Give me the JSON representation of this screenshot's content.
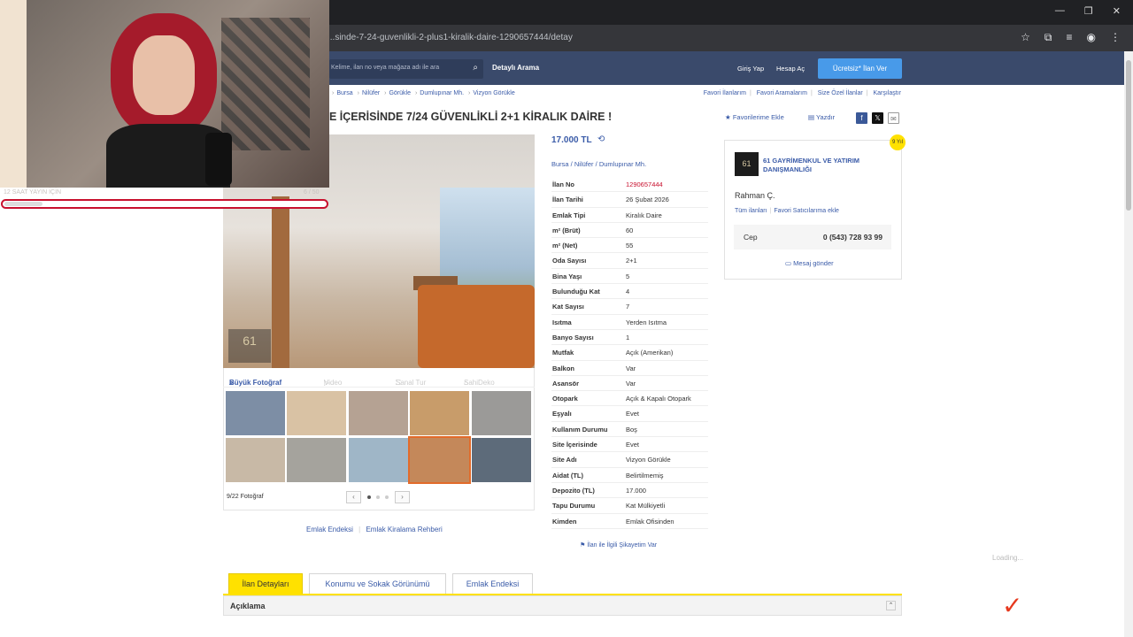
{
  "browser": {
    "url": "...sinde-7-24-guvenlikli-2-plus1-kiralik-daire-1290657444/detay",
    "window_controls": [
      "—",
      "❐",
      "✕"
    ],
    "toolbar_icons": [
      "star-icon",
      "extensions-icon",
      "media-icon",
      "profile-icon",
      "menu-icon"
    ]
  },
  "header": {
    "search_placeholder": "Kelime, ilan no veya mağaza adı ile ara",
    "detailed_search": "Detaylı Arama",
    "login": "Giriş Yap",
    "register": "Hesap Aç",
    "post_ad": "Ücretsiz* İlan Ver"
  },
  "breadcrumb": {
    "items": [
      "Bursa",
      "Nilüfer",
      "Görükle",
      "Dumlupınar Mh.",
      "Vizyon Görükle"
    ],
    "links": [
      "Favori İlanlarım",
      "Favori Aramalarım",
      "Size Özel İlanlar",
      "Karşılaştır"
    ]
  },
  "listing": {
    "title": "E İÇERİSİNDE 7/24 GÜVENLİKLİ 2+1 KİRALIK DAİRE !",
    "add_favorite": "Favorilerime Ekle",
    "print": "Yazdır",
    "price": "17.000 TL",
    "location": [
      "Bursa",
      "Nilüfer",
      "Dumlupınar Mh."
    ],
    "details": [
      {
        "k": "İlan No",
        "v": "1290657444",
        "red": true
      },
      {
        "k": "İlan Tarihi",
        "v": "26 Şubat 2026"
      },
      {
        "k": "Emlak Tipi",
        "v": "Kiralık Daire"
      },
      {
        "k": "m² (Brüt)",
        "v": "60"
      },
      {
        "k": "m² (Net)",
        "v": "55"
      },
      {
        "k": "Oda Sayısı",
        "v": "2+1"
      },
      {
        "k": "Bina Yaşı",
        "v": "5"
      },
      {
        "k": "Bulunduğu Kat",
        "v": "4"
      },
      {
        "k": "Kat Sayısı",
        "v": "7"
      },
      {
        "k": "Isıtma",
        "v": "Yerden Isıtma"
      },
      {
        "k": "Banyo Sayısı",
        "v": "1"
      },
      {
        "k": "Mutfak",
        "v": "Açık (Amerikan)"
      },
      {
        "k": "Balkon",
        "v": "Var"
      },
      {
        "k": "Asansör",
        "v": "Var"
      },
      {
        "k": "Otopark",
        "v": "Açık & Kapalı Otopark"
      },
      {
        "k": "Eşyalı",
        "v": "Evet"
      },
      {
        "k": "Kullanım Durumu",
        "v": "Boş"
      },
      {
        "k": "Site İçerisinde",
        "v": "Evet"
      },
      {
        "k": "Site Adı",
        "v": "Vizyon Görükle"
      },
      {
        "k": "Aidat (TL)",
        "v": "Belirtilmemiş"
      },
      {
        "k": "Depozito (TL)",
        "v": "17.000"
      },
      {
        "k": "Tapu Durumu",
        "v": "Kat Mülkiyetli"
      },
      {
        "k": "Kimden",
        "v": "Emlak Ofisinden"
      }
    ],
    "complaint": "İlan ile İlgili Şikayetim Var"
  },
  "gallery": {
    "tabs": [
      "Büyük Fotoğraf",
      "Video",
      "Sanal Tur",
      "SahiDeko"
    ],
    "photo_count": "9/22 Fotoğraf",
    "logo_text": "61",
    "below_links": [
      "Emlak Endeksi",
      "Emlak Kiralama Rehberi"
    ],
    "thumb_colors": [
      "#7d8ea5",
      "#d9c2a4",
      "#b5a293",
      "#c89c6a",
      "#9b9a98",
      "#c8b9a6",
      "#a5a39d",
      "#9fb6c7",
      "#c4885a",
      "#5d6b7a"
    ]
  },
  "seller": {
    "name": "61 GAYRİMENKUL VE YATIRIM DANIŞMANLIĞI",
    "person": "Rahman Ç.",
    "all_listings": "Tüm ilanları",
    "add_fav_seller": "Favori Satıcılarıma ekle",
    "phone_label": "Cep",
    "phone": "0 (543) 728 93 99",
    "message": "Mesaj gönder",
    "badge_text": "9 Yıl",
    "logo_text": "61"
  },
  "bottom_tabs": [
    "İlan Detayları",
    "Konumu ve Sokak Görünümü",
    "Emlak Endeksi"
  ],
  "section_title": "Açıklama",
  "loading": "Loading...",
  "stream_overlay": {
    "goal_text": "12 SAAT YAYIN İÇİN",
    "goal_count": "6 / 50",
    "progress": 0.12
  },
  "colors": {
    "header": "#3a4a6b",
    "link": "#3a5ba8",
    "accent_yellow": "#ffe100",
    "post_ad_button": "#489ae9",
    "red": "#c8102e"
  }
}
